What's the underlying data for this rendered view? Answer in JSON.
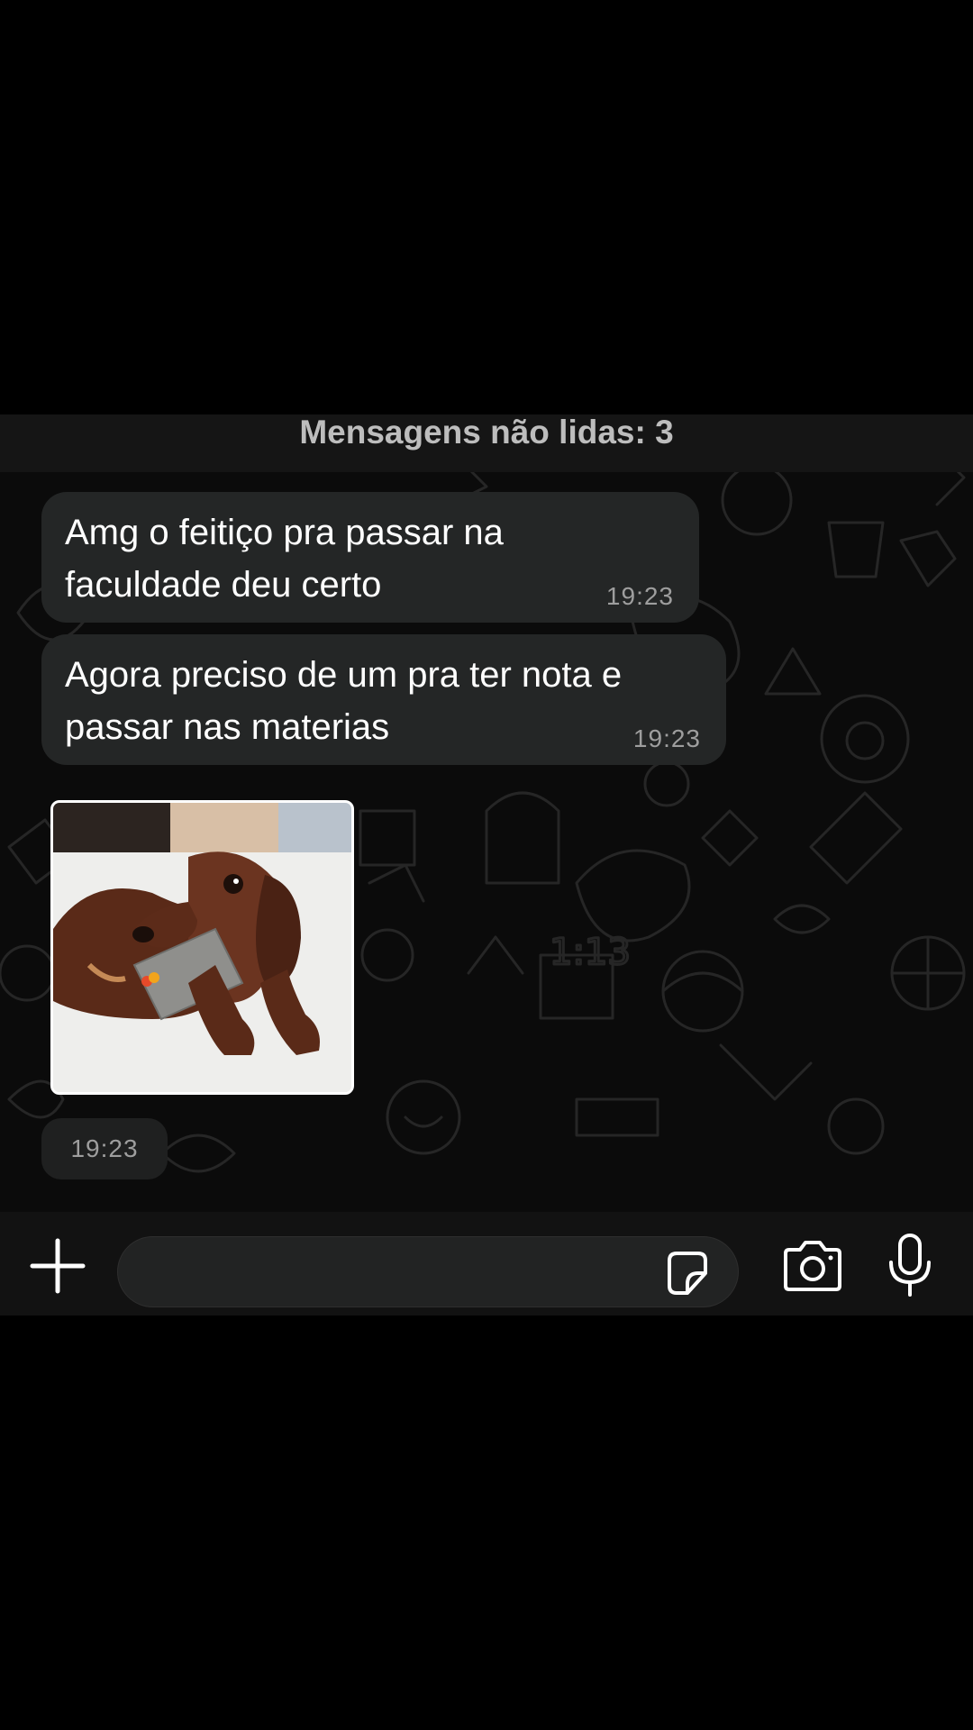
{
  "banner": {
    "unread_label": "Mensagens não lidas: 3"
  },
  "messages": [
    {
      "text": "Amg o feitiço pra passar na\nfaculdade deu certo",
      "time": "19:23"
    },
    {
      "text": "Agora preciso de um pra ter nota e\npassar nas materias",
      "time": "19:23"
    }
  ],
  "sticker": {
    "description_icon": "dachshund-with-credit-card-sticker",
    "time": "19:23"
  },
  "input_bar": {
    "message_value": "",
    "icons": [
      "plus-icon",
      "sticker-icon",
      "camera-icon",
      "microphone-icon"
    ]
  },
  "colors": {
    "background": "#000000",
    "chat_background": "#0b0b0b",
    "bubble": "#242626",
    "timestamp": "#9e9e9e",
    "banner_text": "#bdbdbd"
  }
}
